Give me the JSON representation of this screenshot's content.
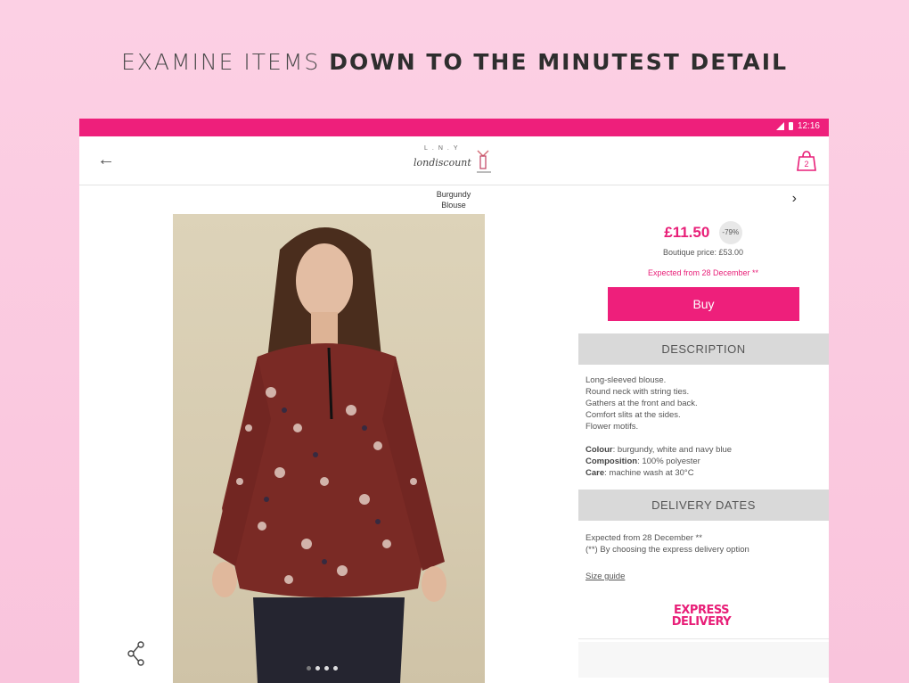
{
  "banner": {
    "light_text": "EXAMINE ITEMS ",
    "bold_text": "DOWN TO THE MINUTEST DETAIL"
  },
  "status_bar": {
    "time": "12:16",
    "accent": "#ee1f7b"
  },
  "app_bar": {
    "back_icon": "arrow-left-icon",
    "logo_top": "L.N.Y",
    "logo_script": "londiscount",
    "bag_icon": "shopping-bag-icon",
    "bag_count": "2"
  },
  "product": {
    "title_line1": "Burgundy",
    "title_line2": "Blouse",
    "price": "£11.50",
    "discount": "-79%",
    "boutique_price": "Boutique price: £53.00",
    "expected": "Expected from 28 December **",
    "buy_label": "Buy",
    "description_header": "DESCRIPTION",
    "description_lines": [
      "Long-sleeved blouse.",
      "Round neck with string ties.",
      "Gathers at the front and back.",
      "Comfort slits at the sides.",
      "Flower motifs."
    ],
    "colour_label": "Colour",
    "colour_value": ": burgundy, white and navy blue",
    "composition_label": "Composition",
    "composition_value": ": 100% polyester",
    "care_label": "Care",
    "care_value": ": machine wash at 30°C",
    "delivery_header": "DELIVERY DATES",
    "delivery_line1": "Expected from 28 December **",
    "delivery_line2": "(**) By choosing the express delivery option",
    "size_guide": "Size guide",
    "express_line1": "EXPRESS",
    "express_line2": "DELIVERY"
  },
  "colors": {
    "brand_pink": "#ee1f7b",
    "background": "#fcd0e4"
  }
}
